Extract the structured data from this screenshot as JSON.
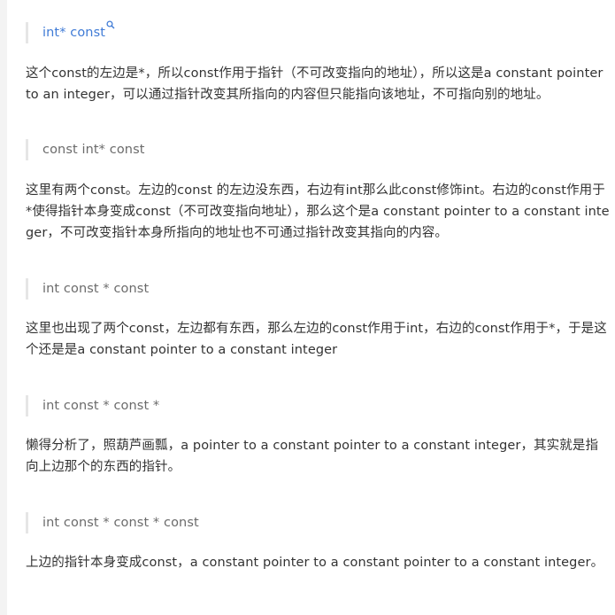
{
  "sections": [
    {
      "code": "int* const",
      "text": "这个const的左边是*，所以const作用于指针（不可改变指向的地址），所以这是a constant pointer to an integer，可以通过指针改变其所指向的内容但只能指向该地址，不可指向别的地址。"
    },
    {
      "code": "const int* const",
      "text": "这里有两个const。左边的const 的左边没东西，右边有int那么此const修饰int。右边的const作用于*使得指针本身变成const（不可改变指向地址），那么这个是a constant pointer to a constant integer，不可改变指针本身所指向的地址也不可通过指针改变其指向的内容。"
    },
    {
      "code": "int const * const",
      "text": "这里也出现了两个const，左边都有东西，那么左边的const作用于int，右边的const作用于*，于是这个还是是a constant pointer to a constant integer"
    },
    {
      "code": "int const * const *",
      "text": "懒得分析了，照葫芦画瓢，a pointer to a constant pointer to a constant integer，其实就是指向上边那个的东西的指针。"
    },
    {
      "code": "int const * const * const",
      "text": "上边的指针本身变成const，a constant pointer to a constant pointer to a constant integer。"
    }
  ],
  "icons": {
    "search": "search-icon"
  },
  "colors": {
    "link": "#3f7bd6",
    "muted": "#6b6b6b",
    "body": "#333333",
    "quote_border": "#e6e6e6"
  }
}
